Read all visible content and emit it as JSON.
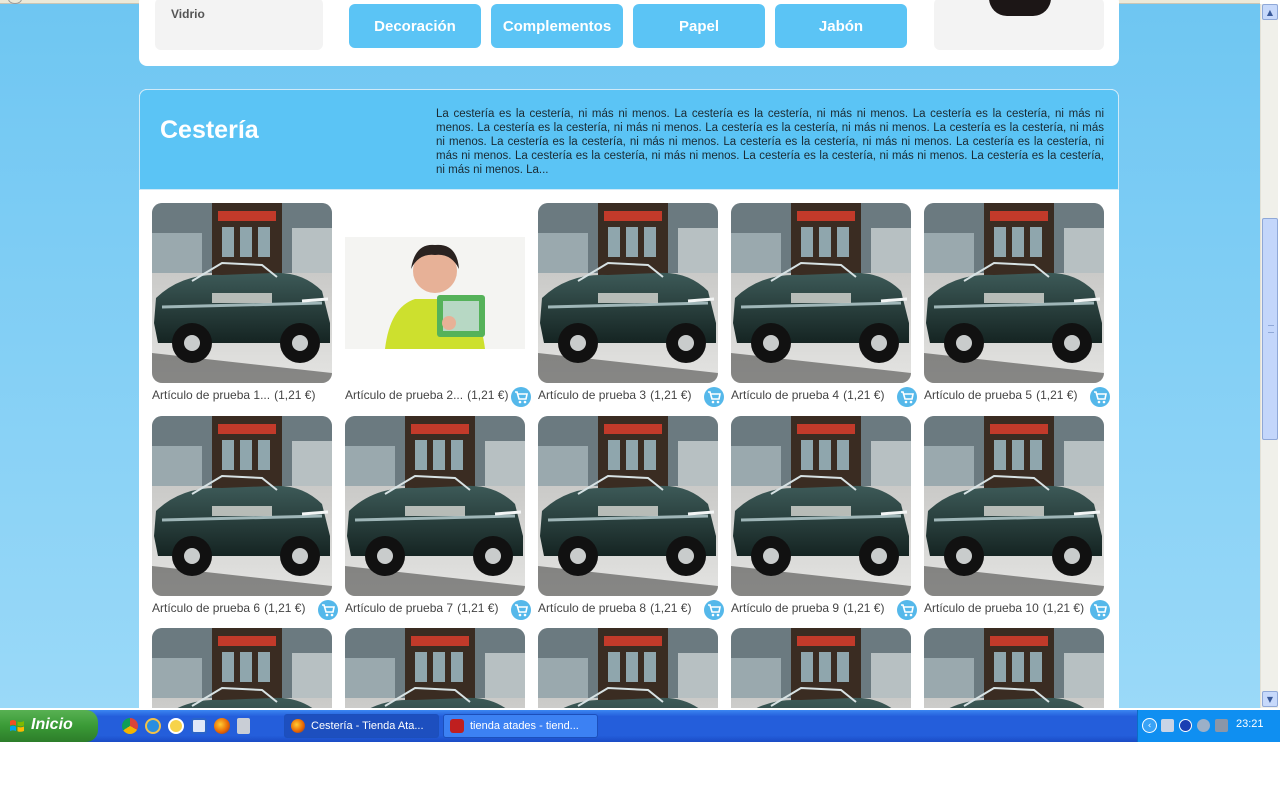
{
  "header": {
    "left_box_label": "Vidrio",
    "categories": [
      "Decoración",
      "Complementos",
      "Papel",
      "Jabón"
    ]
  },
  "category": {
    "title": "Cestería",
    "description": "La cestería es la cestería, ni más ni menos. La cestería es la cestería, ni más ni menos. La cestería es la cestería, ni más ni menos. La cestería es la cestería, ni más ni menos. La cestería es la cestería, ni más ni menos. La cestería es la cestería, ni más ni menos. La cestería es la cestería, ni más ni menos. La cestería es la cestería, ni más ni menos. La cestería es la cestería, ni más ni menos. La cestería es la cestería, ni más ni menos. La cestería es la cestería, ni más ni menos. La cestería es la cestería, ni más ni menos. La..."
  },
  "products": [
    {
      "name": "Artículo de prueba 1...",
      "price": "(1,21 €)",
      "image": "vintage-car-photo",
      "cart": false
    },
    {
      "name": "Artículo de prueba 2...",
      "price": "(1,21 €)",
      "image": "woman-with-basket-photo",
      "cart": true
    },
    {
      "name": "Artículo de prueba 3",
      "price": "(1,21 €)",
      "image": "vintage-car-photo",
      "cart": true
    },
    {
      "name": "Artículo de prueba 4",
      "price": "(1,21 €)",
      "image": "vintage-car-photo",
      "cart": true
    },
    {
      "name": "Artículo de prueba 5",
      "price": "(1,21 €)",
      "image": "vintage-car-photo",
      "cart": true
    },
    {
      "name": "Artículo de prueba 6",
      "price": "(1,21 €)",
      "image": "vintage-car-photo",
      "cart": true
    },
    {
      "name": "Artículo de prueba 7",
      "price": "(1,21 €)",
      "image": "vintage-car-photo",
      "cart": true
    },
    {
      "name": "Artículo de prueba 8",
      "price": "(1,21 €)",
      "image": "vintage-car-photo",
      "cart": true
    },
    {
      "name": "Artículo de prueba 9",
      "price": "(1,21 €)",
      "image": "vintage-car-photo",
      "cart": true
    },
    {
      "name": "Artículo de prueba 10",
      "price": "(1,21 €)",
      "image": "vintage-car-photo",
      "cart": true
    },
    {
      "name": "",
      "price": "",
      "image": "vintage-car-photo",
      "cart": false
    },
    {
      "name": "",
      "price": "",
      "image": "vintage-car-photo",
      "cart": false
    },
    {
      "name": "",
      "price": "",
      "image": "vintage-car-photo",
      "cart": false
    },
    {
      "name": "",
      "price": "",
      "image": "vintage-car-photo",
      "cart": false
    },
    {
      "name": "",
      "price": "",
      "image": "vintage-car-photo",
      "cart": false
    }
  ],
  "icons": {
    "cart": "shopping-cart-icon",
    "scroll_up": "scroll-up-arrow-icon",
    "scroll_down": "scroll-down-arrow-icon",
    "start": "windows-flag-icon"
  },
  "colors": {
    "accent": "#5bc4f5",
    "page_background": "#6ec6f2",
    "taskbar": "#245edb",
    "start_button": "#3a9a36"
  },
  "taskbar": {
    "start_label": "Inicio",
    "quick_launch": [
      "chrome-icon",
      "internet-explorer-icon",
      "messenger-icon",
      "outlook-express-icon",
      "firefox-icon",
      "calculator-icon"
    ],
    "tasks": [
      {
        "label": "Cestería - Tienda Ata...",
        "icon": "firefox-icon",
        "active": true
      },
      {
        "label": "tienda atades - tiend...",
        "icon": "filezilla-icon",
        "active": false
      }
    ],
    "tray_icons": [
      "network-icon",
      "bluetooth-icon",
      "settings-icon",
      "monitor-icon"
    ],
    "clock": "23:21"
  }
}
